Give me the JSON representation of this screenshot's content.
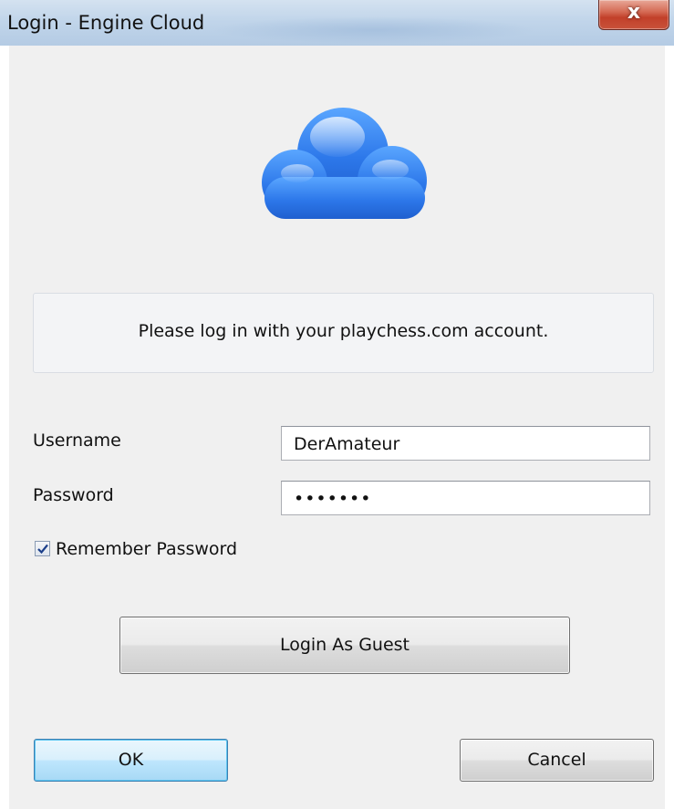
{
  "window": {
    "title": "Login - Engine Cloud",
    "close_glyph": "x"
  },
  "header": {
    "icon": "cloud-icon",
    "icon_color": "#2f7ae6"
  },
  "info": {
    "message": "Please log in with your playchess.com account."
  },
  "form": {
    "username_label": "Username",
    "username_value": "DerAmateur",
    "password_label": "Password",
    "password_value": "•••••••",
    "remember_label": "Remember Password",
    "remember_checked": true
  },
  "buttons": {
    "guest": "Login As Guest",
    "ok": "OK",
    "cancel": "Cancel"
  }
}
